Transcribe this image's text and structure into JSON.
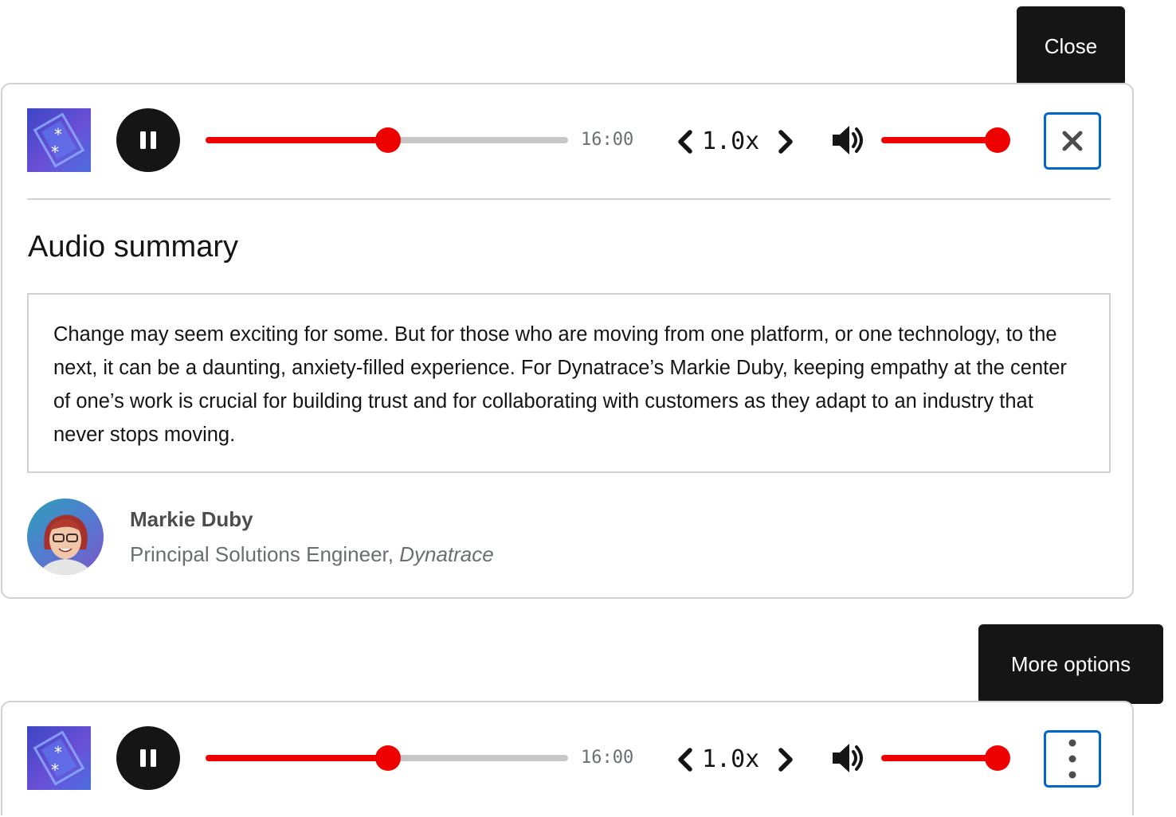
{
  "players": [
    {
      "time": "16:00",
      "playback_rate": "1.0x",
      "progress_fraction": 0.503,
      "volume_fraction": 1.0,
      "action_button": "close",
      "tooltip": "Close"
    },
    {
      "time": "16:00",
      "playback_rate": "1.0x",
      "progress_fraction": 0.503,
      "volume_fraction": 1.0,
      "action_button": "more-options",
      "tooltip": "More options"
    }
  ],
  "summary": {
    "title": "Audio summary",
    "text": "Change may seem exciting for some. But for those who are moving from one platform, or one technology, to the next, it can be a daunting, anxiety-filled experience. For Dynatrace’s Markie Duby, keeping empathy at the center of one’s work is crucial for building trust and for collaborating with customers as they adapt to an industry that never stops moving."
  },
  "author": {
    "name": "Markie Duby",
    "title": "Principal Solutions Engineer, ",
    "company": "Dynatrace"
  },
  "icons": [
    "cover-art-icon",
    "pause-icon",
    "chevron-left-icon",
    "chevron-right-icon",
    "volume-icon",
    "close-icon",
    "kebab-icon"
  ],
  "colors": {
    "accent": "#ee0000",
    "track": "#c7c7c7",
    "focus": "#0066cc",
    "tooltip_bg": "#151515",
    "text": "#151515",
    "muted": "#6a6e73"
  }
}
